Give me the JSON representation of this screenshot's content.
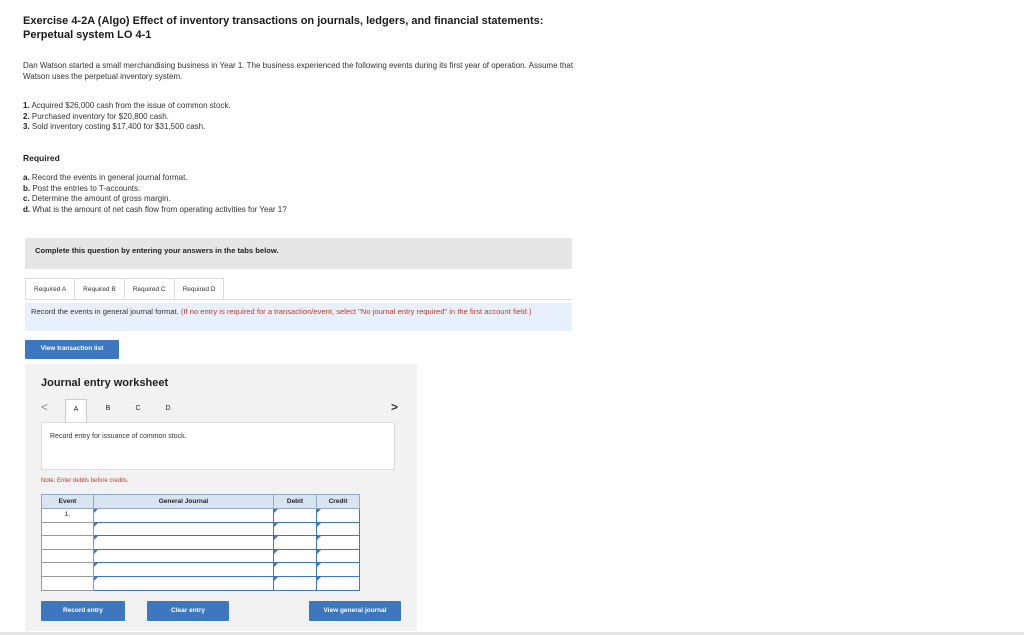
{
  "exercise": {
    "title": "Exercise 4-2A (Algo) Effect of inventory transactions on journals, ledgers, and financial statements: Perpetual system LO 4-1",
    "intro": "Dan Watson started a small merchandising business in Year 1. The business experienced the following events during its first year of operation. Assume that Watson uses the perpetual inventory system.",
    "events": [
      {
        "num": "1.",
        "text": "Acquired $26,000 cash from the issue of common stock."
      },
      {
        "num": "2.",
        "text": "Purchased inventory for $20,800 cash."
      },
      {
        "num": "3.",
        "text": "Sold inventory costing $17,400 for $31,500 cash."
      }
    ],
    "required_heading": "Required",
    "requirements": [
      {
        "letter": "a.",
        "text": "Record the events in general journal format."
      },
      {
        "letter": "b.",
        "text": "Post the entries to T-accounts."
      },
      {
        "letter": "c.",
        "text": "Determine the amount of gross margin."
      },
      {
        "letter": "d.",
        "text": "What is the amount of net cash flow from operating activities for Year 1?"
      }
    ]
  },
  "complete_banner": "Complete this question by entering your answers in the tabs below.",
  "tabs": [
    "Required A",
    "Required B",
    "Required C",
    "Required D"
  ],
  "instruction": {
    "main": "Record the events in general journal format.",
    "note": "(If no entry is required for a transaction/event, select \"No journal entry required\" in the first account field.)"
  },
  "view_transaction_list": "View transaction list",
  "worksheet": {
    "title": "Journal entry worksheet",
    "nav_prev": "<",
    "nav_next": ">",
    "tabs": [
      "A",
      "B",
      "C",
      "D"
    ],
    "entry_description": "Record entry for issuance of common stock.",
    "note": "Note: Enter debits before credits.",
    "columns": [
      "Event",
      "General Journal",
      "Debit",
      "Credit"
    ],
    "rows": [
      {
        "event": "1."
      },
      {
        "event": ""
      },
      {
        "event": ""
      },
      {
        "event": ""
      },
      {
        "event": ""
      },
      {
        "event": ""
      }
    ],
    "buttons": {
      "record": "Record entry",
      "clear": "Clear entry",
      "view_general": "View general journal"
    }
  }
}
